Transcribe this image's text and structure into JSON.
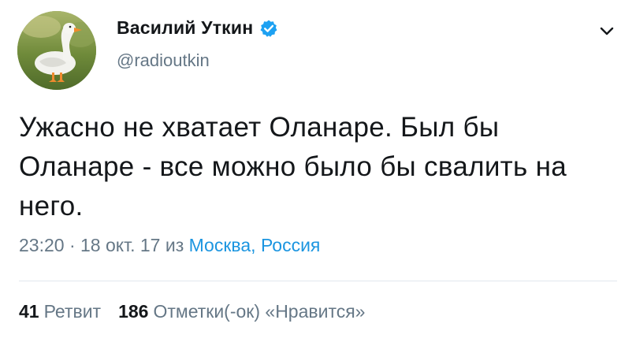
{
  "author": {
    "display_name": "Василий Уткин",
    "handle": "@radioutkin",
    "verified": true
  },
  "tweet": {
    "text": "Ужасно не хватает Оланаре. Был бы Оланаре - все можно было бы свалить на него.",
    "time": "23:20",
    "separator": " · ",
    "date": "18 окт. 17",
    "from_word": " из ",
    "location": "Москва, Россия"
  },
  "stats": {
    "retweets_count": "41",
    "retweets_label": "Ретвит",
    "likes_count": "186",
    "likes_label": "Отметки(-ок) «Нравится»"
  },
  "icons": {
    "verified": "verified-badge-icon",
    "menu": "chevron-down-icon"
  },
  "colors": {
    "link": "#1b95e0",
    "muted": "#657786",
    "verified": "#1da1f2",
    "divider": "#e1e8ed"
  }
}
